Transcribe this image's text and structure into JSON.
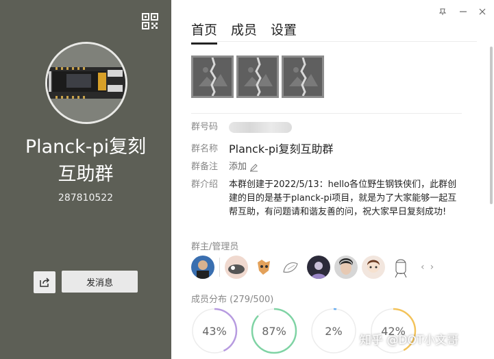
{
  "left": {
    "group_name_line1": "Planck-pi复刻",
    "group_name_line2": "互助群",
    "group_id": "287810522",
    "message_button": "发消息",
    "icons": {
      "qr": "qr-code-icon",
      "share": "share-icon"
    }
  },
  "window": {
    "controls": [
      "pin-icon",
      "minimize-icon",
      "close-icon"
    ]
  },
  "tabs": [
    {
      "label": "首页",
      "active": true
    },
    {
      "label": "成员",
      "active": false
    },
    {
      "label": "设置",
      "active": false
    }
  ],
  "info": {
    "group_number_label": "群号码",
    "group_name_label": "群名称",
    "group_name_value": "Planck-pi复刻互助群",
    "remark_label": "群备注",
    "remark_value": "添加",
    "intro_label": "群介绍",
    "intro_value": "本群创建于2022/5/13：hello各位野生钢铁侠们，此群创建的目的是基于planck-pi项目，就是为了大家能够一起互帮互助，有问题请和谐友善的问，祝大家早日复刻成功!"
  },
  "admins": {
    "title": "群主/管理员",
    "count_shown": 8
  },
  "distribution": {
    "title": "成员分布",
    "count": "(279/500)",
    "rings": [
      {
        "label": "43%",
        "value": 0.43,
        "color": "#b79be0"
      },
      {
        "label": "87%",
        "value": 0.87,
        "color": "#7fd3a4"
      },
      {
        "label": "2%",
        "value": 0.02,
        "color": "#6aaef0"
      },
      {
        "label": "42%",
        "value": 0.42,
        "color": "#f3c35a"
      }
    ]
  },
  "watermark": "知乎 @DOT小文哥"
}
